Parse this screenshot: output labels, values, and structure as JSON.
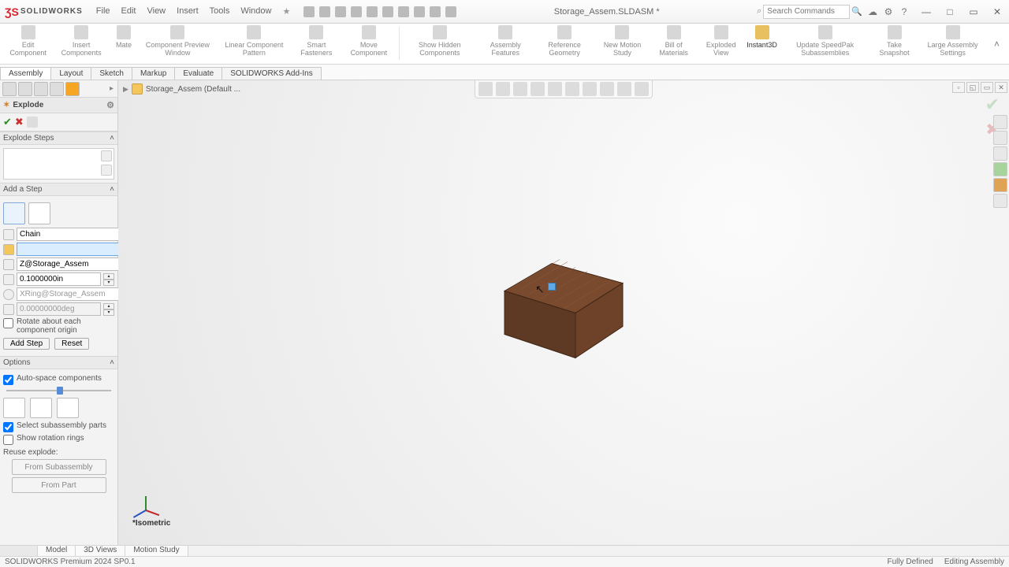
{
  "app": {
    "brand": "SOLIDWORKS",
    "doc_title": "Storage_Assem.SLDASM *"
  },
  "menubar": [
    "File",
    "Edit",
    "View",
    "Insert",
    "Tools",
    "Window"
  ],
  "search": {
    "placeholder": "Search Commands"
  },
  "ribbon": {
    "commands": [
      {
        "label": "Edit Component"
      },
      {
        "label": "Insert Components"
      },
      {
        "label": "Mate"
      },
      {
        "label": "Component Preview Window"
      },
      {
        "label": "Linear Component Pattern"
      },
      {
        "label": "Smart Fasteners"
      },
      {
        "label": "Move Component"
      },
      {
        "label": "Show Hidden Components"
      },
      {
        "label": "Assembly Features"
      },
      {
        "label": "Reference Geometry"
      },
      {
        "label": "New Motion Study"
      },
      {
        "label": "Bill of Materials"
      },
      {
        "label": "Exploded View"
      },
      {
        "label": "Instant3D",
        "active": true
      },
      {
        "label": "Update SpeedPak Subassemblies"
      },
      {
        "label": "Take Snapshot"
      },
      {
        "label": "Large Assembly Settings"
      }
    ]
  },
  "doc_tabs": [
    "Assembly",
    "Layout",
    "Sketch",
    "Markup",
    "Evaluate",
    "SOLIDWORKS Add-Ins"
  ],
  "breadcrumb": "Storage_Assem (Default ...",
  "pm": {
    "title": "Explode",
    "sec_steps": "Explode Steps",
    "sec_add": "Add a Step",
    "chain_label": "Chain",
    "dir_field": "Z@Storage_Assem",
    "dist_field": "0.1000000in",
    "rot_axis": "XRing@Storage_Assem",
    "rot_deg": "0.00000000deg",
    "rotate_about": "Rotate about each component origin",
    "btn_add": "Add Step",
    "btn_reset": "Reset",
    "sec_options": "Options",
    "auto_space": "Auto-space components",
    "select_sub": "Select subassembly parts",
    "show_rings": "Show rotation rings",
    "reuse_hdr": "Reuse explode:",
    "btn_from_sub": "From Subassembly",
    "btn_from_part": "From Part"
  },
  "viewport": {
    "viewname": "*Isometric"
  },
  "view_tabs": [
    "Model",
    "3D Views",
    "Motion Study"
  ],
  "status": {
    "left": "SOLIDWORKS Premium 2024 SP0.1",
    "defined": "Fully Defined",
    "mode": "Editing Assembly"
  },
  "colors": {
    "wood_top": "#7a4a2e",
    "wood_side": "#5e3a24",
    "wood_front": "#6d4229"
  }
}
